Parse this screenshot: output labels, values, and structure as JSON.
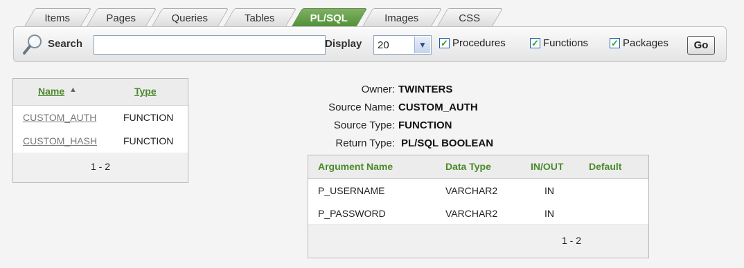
{
  "tabs": [
    {
      "label": "Items",
      "active": false
    },
    {
      "label": "Pages",
      "active": false
    },
    {
      "label": "Queries",
      "active": false
    },
    {
      "label": "Tables",
      "active": false
    },
    {
      "label": "PL/SQL",
      "active": true
    },
    {
      "label": "Images",
      "active": false
    },
    {
      "label": "CSS",
      "active": false
    }
  ],
  "search": {
    "icon": "magnifier-icon",
    "label": "Search",
    "value": "",
    "display_label": "Display",
    "display_value": "20",
    "checkboxes": [
      {
        "label": "Procedures",
        "checked": true
      },
      {
        "label": "Functions",
        "checked": true
      },
      {
        "label": "Packages",
        "checked": true
      }
    ],
    "go_label": "Go"
  },
  "objects": {
    "headers": {
      "name": "Name",
      "type": "Type"
    },
    "sort_icon": "sort-ascending-icon",
    "rows": [
      {
        "name": "CUSTOM_AUTH",
        "type": "FUNCTION"
      },
      {
        "name": "CUSTOM_HASH",
        "type": "FUNCTION"
      }
    ],
    "pagination": "1 - 2"
  },
  "details": {
    "owner_label": "Owner:",
    "owner": "TWINTERS",
    "source_name_label": "Source Name:",
    "source_name": "CUSTOM_AUTH",
    "source_type_label": "Source Type:",
    "source_type": "FUNCTION",
    "return_type_label": "Return Type:",
    "return_type": "PL/SQL BOOLEAN"
  },
  "arguments": {
    "headers": {
      "name": "Argument Name",
      "data_type": "Data Type",
      "in_out": "IN/OUT",
      "default": "Default"
    },
    "rows": [
      {
        "name": "P_USERNAME",
        "data_type": "VARCHAR2",
        "in_out": "IN",
        "default": ""
      },
      {
        "name": "P_PASSWORD",
        "data_type": "VARCHAR2",
        "in_out": "IN",
        "default": ""
      }
    ],
    "pagination": "1 - 2"
  },
  "colors": {
    "accent_green": "#4a8a2a",
    "active_tab": "#5e9c43",
    "background": "#f4f4f4"
  }
}
